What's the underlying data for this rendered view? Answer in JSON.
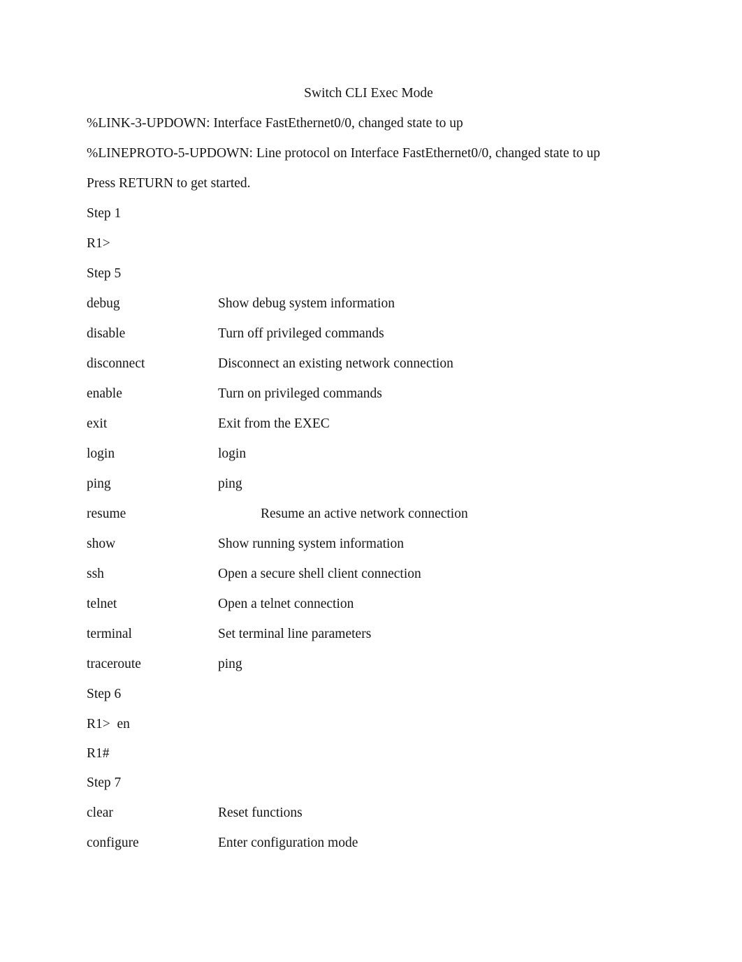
{
  "document": {
    "title": "Switch CLI Exec Mode",
    "background_color": "#ffffff",
    "text_color": "#161616"
  },
  "log_lines": [
    "%LINK-3-UPDOWN: Interface FastEthernet0/0, changed state to up",
    "%LINEPROTO-5-UPDOWN: Line protocol on Interface FastEthernet0/0, changed state to up",
    "Press RETURN to get started."
  ],
  "sections": {
    "step1_label": "Step 1",
    "step1_prompt": "R1>",
    "step5_label": "Step 5",
    "step6_label": "Step 6",
    "step6_prompt": "R1>  en",
    "step6_prompt2": "R1#",
    "step7_label": "Step 7"
  },
  "step5_commands": [
    {
      "name": "debug",
      "desc": "Show debug system information",
      "indented": false
    },
    {
      "name": "disable",
      "desc": "Turn off privileged commands",
      "indented": false
    },
    {
      "name": "disconnect",
      "desc": "Disconnect an existing network connection",
      "indented": false
    },
    {
      "name": "enable",
      "desc": "Turn on privileged commands",
      "indented": false
    },
    {
      "name": "exit",
      "desc": "Exit from the EXEC",
      "indented": false
    },
    {
      "name": "login",
      "desc": "login",
      "indented": false
    },
    {
      "name": "ping",
      "desc": "ping",
      "indented": false
    },
    {
      "name": "resume",
      "desc": "Resume an active network connection",
      "indented": true
    },
    {
      "name": "show",
      "desc": "Show running system information",
      "indented": false
    },
    {
      "name": "ssh",
      "desc": "Open a secure shell client connection",
      "indented": false
    },
    {
      "name": "telnet",
      "desc": "Open a telnet connection",
      "indented": false
    },
    {
      "name": "terminal",
      "desc": "Set terminal line parameters",
      "indented": false
    },
    {
      "name": "traceroute",
      "desc": "ping",
      "indented": false
    }
  ],
  "step7_commands": [
    {
      "name": "clear",
      "desc": "Reset functions",
      "indented": false
    },
    {
      "name": "configure",
      "desc": "Enter configuration mode",
      "indented": false
    }
  ]
}
